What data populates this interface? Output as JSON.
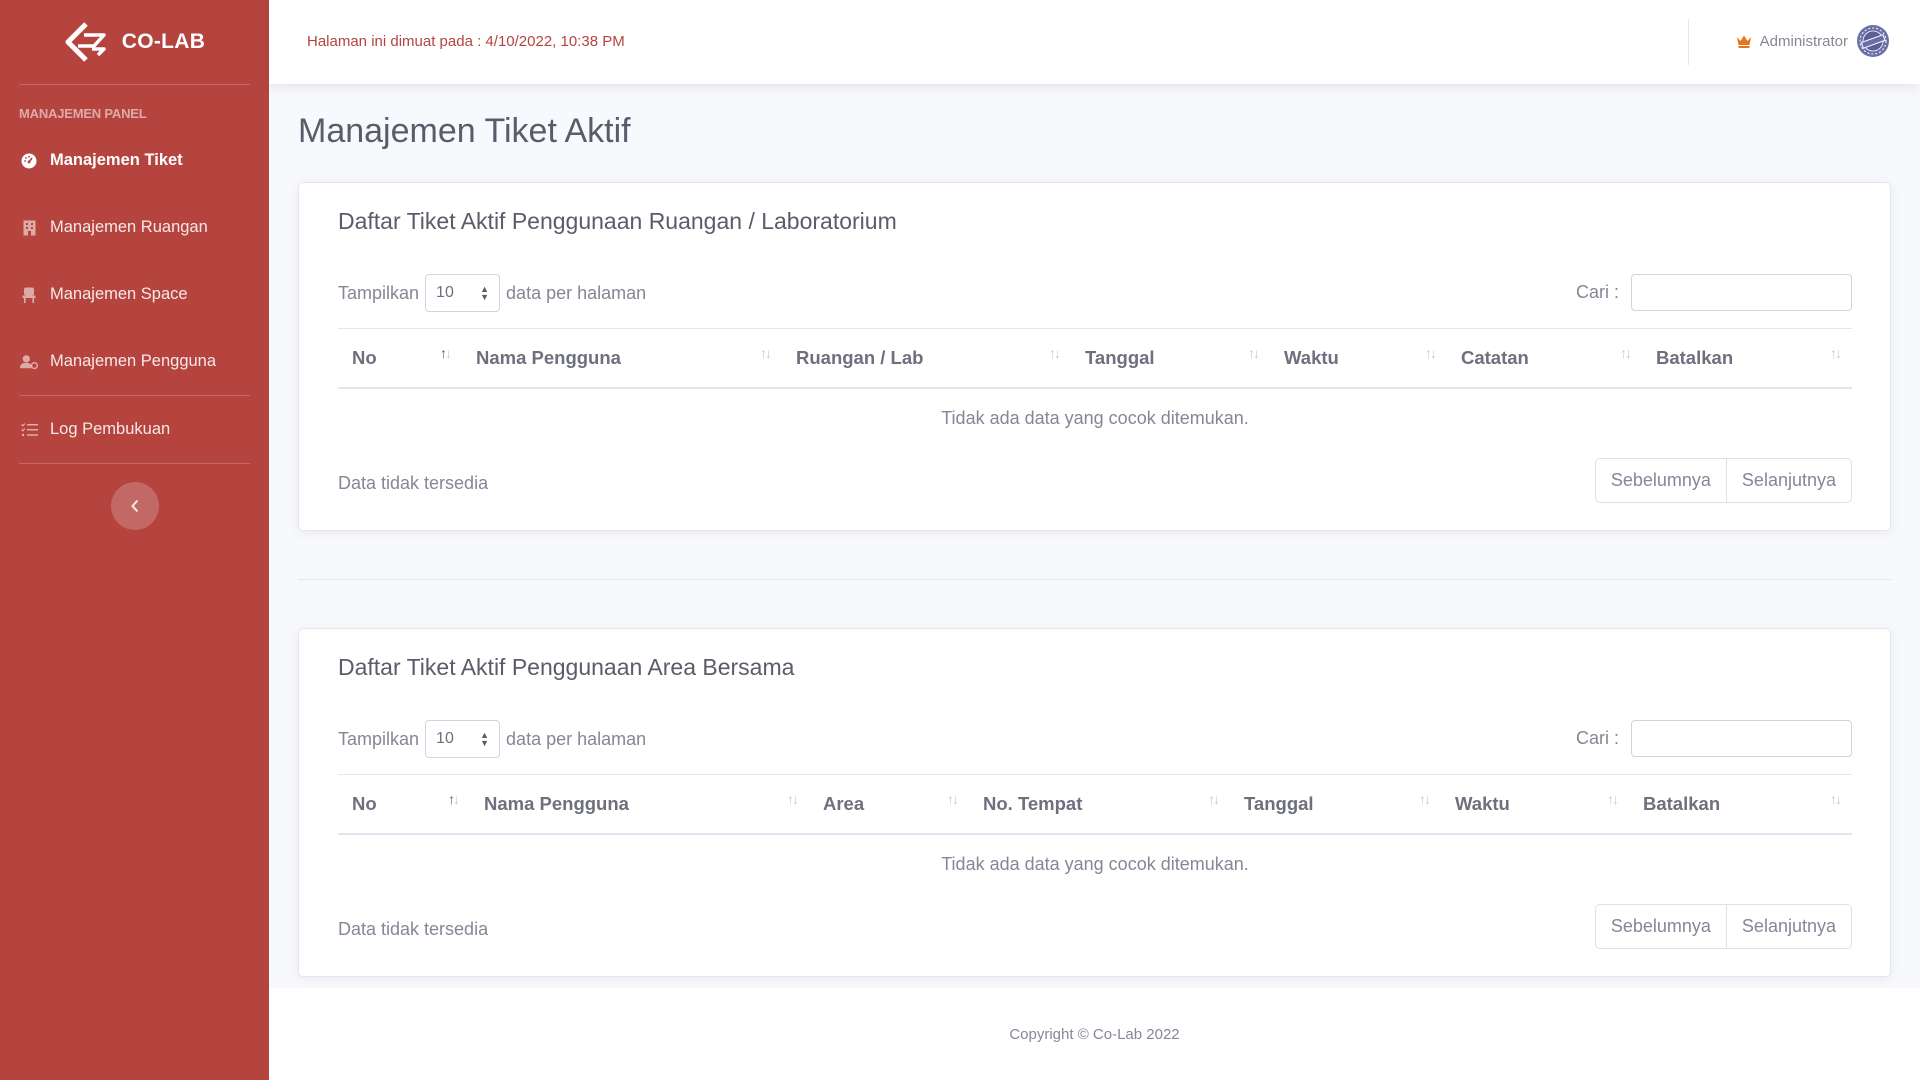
{
  "brand": {
    "name": "CO-LAB"
  },
  "sidebar": {
    "heading": "MANAJEMEN PANEL",
    "items": [
      {
        "label": "Manajemen Tiket",
        "icon": "tachometer-icon",
        "active": true
      },
      {
        "label": "Manajemen Ruangan",
        "icon": "building-icon",
        "active": false
      },
      {
        "label": "Manajemen Space",
        "icon": "chair-icon",
        "active": false
      },
      {
        "label": "Manajemen Pengguna",
        "icon": "users-cog-icon",
        "active": false
      },
      {
        "label": "Log Pembukuan",
        "icon": "list-check-icon",
        "active": false
      }
    ],
    "toggle_icon": "chevron-left-icon"
  },
  "topbar": {
    "loaded_at": "Halaman ini dimuat pada : 4/10/2022, 10:38 PM",
    "user_name": "Administrator",
    "user_icon": "crown-icon"
  },
  "page": {
    "title": "Manajemen Tiket Aktif"
  },
  "card1": {
    "title": "Daftar Tiket Aktif Penggunaan Ruangan / Laboratorium",
    "length_prefix": "Tampilkan",
    "length_value": "10",
    "length_suffix": "data per halaman",
    "search_label": "Cari :",
    "columns": [
      "No",
      "Nama Pengguna",
      "Ruangan / Lab",
      "Tanggal",
      "Waktu",
      "Catatan",
      "Batalkan"
    ],
    "empty_text": "Tidak ada data yang cocok ditemukan.",
    "info": "Data tidak tersedia",
    "prev": "Sebelumnya",
    "next": "Selanjutnya"
  },
  "card2": {
    "title": "Daftar Tiket Aktif Penggunaan Area Bersama",
    "length_prefix": "Tampilkan",
    "length_value": "10",
    "length_suffix": "data per halaman",
    "search_label": "Cari :",
    "columns": [
      "No",
      "Nama Pengguna",
      "Area",
      "No. Tempat",
      "Tanggal",
      "Waktu",
      "Batalkan"
    ],
    "empty_text": "Tidak ada data yang cocok ditemukan.",
    "info": "Data tidak tersedia",
    "prev": "Sebelumnya",
    "next": "Selanjutnya"
  },
  "footer": {
    "copyright": "Copyright © Co-Lab 2022"
  },
  "colors": {
    "sidebar": "#b5443f",
    "accent": "#b5443f",
    "crown": "#e8741c"
  }
}
